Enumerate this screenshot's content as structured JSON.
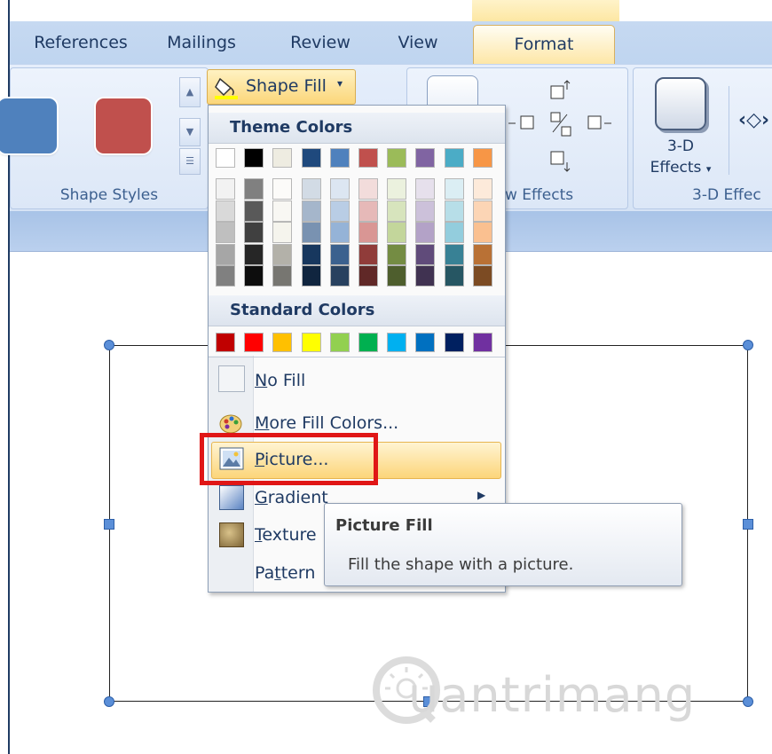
{
  "tabs": {
    "references": "References",
    "mailings": "Mailings",
    "review": "Review",
    "view": "View",
    "format": "Format"
  },
  "ribbon": {
    "shape_styles_label": "Shape Styles",
    "shadow_effects_label": "w Effects",
    "three_d_effects_label": "3-D Effec",
    "three_d_button_line1": "3-D",
    "three_d_button_line2": "Effects",
    "shape_fill_label": "Shape Fill"
  },
  "colors": {
    "style_swatch_blue": "#4f81bd",
    "style_swatch_red": "#c0504d",
    "highlight_box": "#e01616",
    "theme_colors": [
      "#ffffff",
      "#000000",
      "#eeece1",
      "#1f497d",
      "#4f81bd",
      "#c0504d",
      "#9bbb59",
      "#8064a2",
      "#4bacc6",
      "#f79646"
    ],
    "standard_colors": [
      "#c00000",
      "#ff0000",
      "#ffc000",
      "#ffff00",
      "#92d050",
      "#00b050",
      "#00b0f0",
      "#0070c0",
      "#002060",
      "#7030a0"
    ]
  },
  "dropdown": {
    "theme_colors_header": "Theme Colors",
    "standard_colors_header": "Standard Colors",
    "no_fill": "No Fill",
    "more_fill_colors": "More Fill Colors...",
    "picture": "Picture...",
    "gradient": "Gradient",
    "texture": "Texture",
    "pattern": "Pattern"
  },
  "tooltip": {
    "title": "Picture Fill",
    "body": "Fill the shape with a picture."
  },
  "watermark": {
    "text": "uantrimang"
  }
}
